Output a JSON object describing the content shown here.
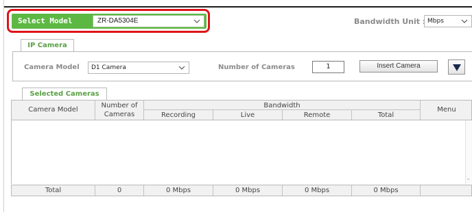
{
  "header": {
    "select_model_label": "Select Model",
    "model_value": "ZR-DA5304E",
    "bandwidth_unit_label": "Bandwidth Unit :",
    "bandwidth_unit_value": "Mbps"
  },
  "ip_camera": {
    "tab_label": "IP Camera",
    "camera_model_label": "Camera Model",
    "camera_model_value": "D1 Camera",
    "number_label": "Number of Cameras",
    "number_value": "1",
    "insert_button": "Insert Camera"
  },
  "selected": {
    "tab_label": "Selected Cameras",
    "columns": {
      "camera_model": "Camera Model",
      "number_line1": "Number of",
      "number_line2": "Cameras",
      "bandwidth": "Bandwidth",
      "recording": "Recording",
      "live": "Live",
      "remote": "Remote",
      "total": "Total",
      "menu": "Menu"
    },
    "total_row": {
      "label": "Total",
      "cameras": "0",
      "recording": "0 Mbps",
      "live": "0 Mbps",
      "remote": "0 Mbps",
      "total": "0 Mbps"
    }
  },
  "colors": {
    "accent_green": "#5cb843",
    "highlight_red": "#e0131a"
  },
  "icons": [
    "chevron-down-icon",
    "triangle-down-icon"
  ]
}
